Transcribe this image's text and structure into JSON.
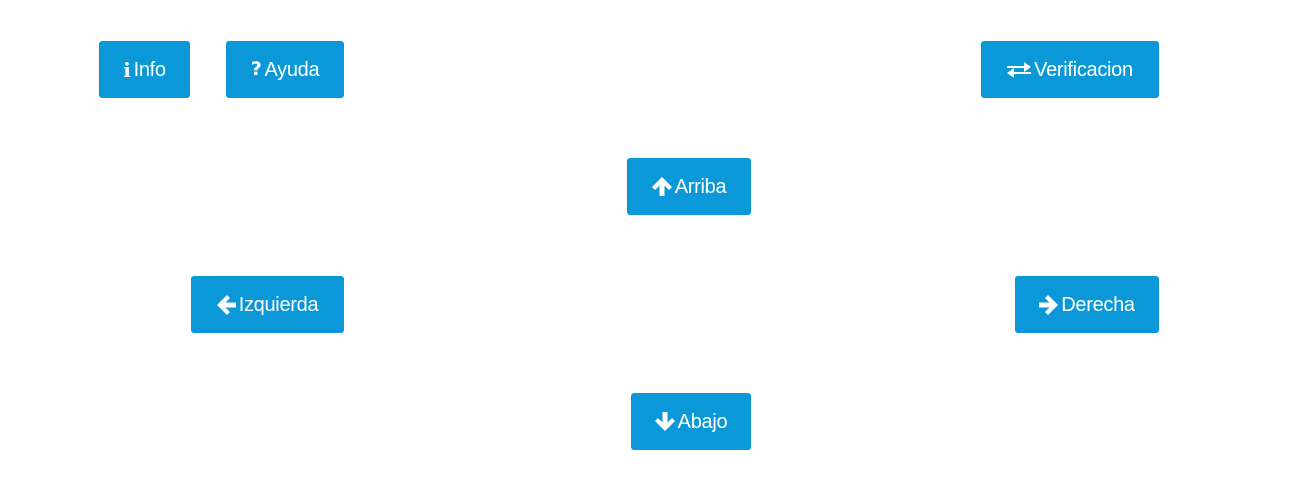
{
  "buttons": {
    "info": {
      "label": "Info",
      "icon": "info-icon"
    },
    "ayuda": {
      "label": "Ayuda",
      "icon": "question-icon"
    },
    "verificacion": {
      "label": "Verificacion",
      "icon": "exchange-icon"
    },
    "arriba": {
      "label": "Arriba",
      "icon": "arrow-up-icon"
    },
    "izquierda": {
      "label": "Izquierda",
      "icon": "arrow-left-icon"
    },
    "derecha": {
      "label": "Derecha",
      "icon": "arrow-right-icon"
    },
    "abajo": {
      "label": "Abajo",
      "icon": "arrow-down-icon"
    }
  },
  "colors": {
    "button_bg": "#0a98d8",
    "button_text": "#ffffff",
    "page_bg": "#ffffff"
  }
}
